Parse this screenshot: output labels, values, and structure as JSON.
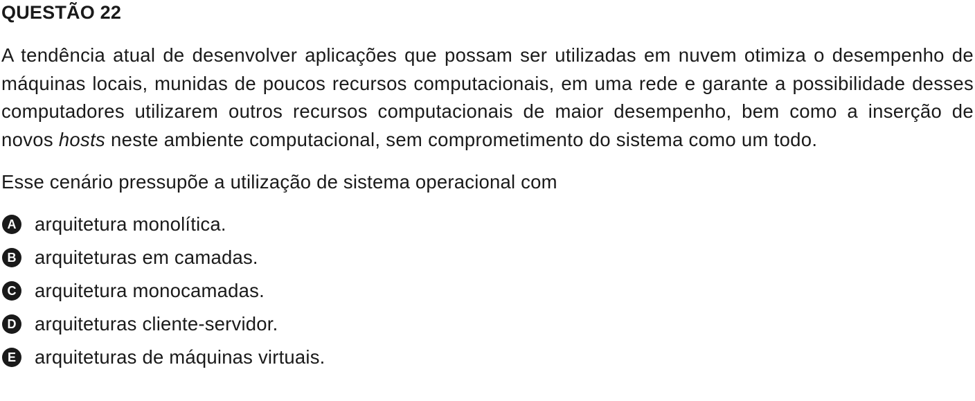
{
  "question": {
    "title": "QUESTÃO 22",
    "text_before": "A tendência atual de desenvolver aplicações que possam ser utilizadas em nuvem otimiza o desempenho de máquinas locais, munidas de poucos recursos computacionais, em uma rede e garante a possibilidade desses computadores utilizarem outros recursos computacionais de maior desempenho, bem como a inserção de novos ",
    "text_emphasis": "hosts",
    "text_after": " neste ambiente computacional, sem comprometimento do sistema como um todo.",
    "stem": "Esse cenário pressupõe a utilização de sistema operacional com",
    "options": [
      {
        "letter": "A",
        "text": "arquitetura monolítica."
      },
      {
        "letter": "B",
        "text": "arquiteturas em camadas."
      },
      {
        "letter": "C",
        "text": "arquitetura monocamadas."
      },
      {
        "letter": "D",
        "text": "arquiteturas cliente-servidor."
      },
      {
        "letter": "E",
        "text": "arquiteturas de máquinas virtuais."
      }
    ]
  }
}
